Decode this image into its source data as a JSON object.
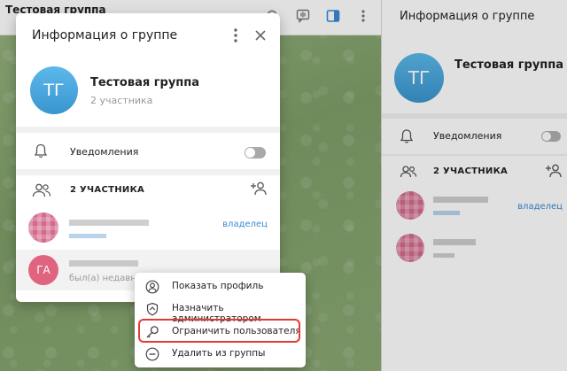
{
  "chat": {
    "title": "Тестовая группа",
    "subtitle": ""
  },
  "right_panel": {
    "header_title": "Информация о группе",
    "avatar_initials": "ТГ",
    "group_name": "Тестовая группа",
    "member_count": "",
    "notifications_label": "Уведомления",
    "members_label": "2 УЧАСТНИКА",
    "owner_label": "владелец"
  },
  "dialog": {
    "title": "Информация о группе",
    "avatar_initials": "ТГ",
    "group_name": "Тестовая группа",
    "member_count": "2 участника",
    "notifications_label": "Уведомления",
    "members_label": "2 УЧАСТНИКА",
    "owner_label": "владелец",
    "member2_initials": "ГА",
    "member2_status": "был(а) недавно"
  },
  "context_menu": {
    "items": [
      {
        "label": "Показать профиль",
        "icon": "profile-icon"
      },
      {
        "label": "Назначить администратором",
        "icon": "shield-icon"
      },
      {
        "label": "Ограничить пользователя",
        "icon": "key-icon"
      },
      {
        "label": "Удалить из группы",
        "icon": "remove-icon"
      }
    ],
    "highlighted_index": 2
  },
  "colors": {
    "accent": "#3a8ad6",
    "avatar_blue": "#3a95cf",
    "avatar_pink": "#e0637f",
    "highlight_red": "#e53935"
  }
}
